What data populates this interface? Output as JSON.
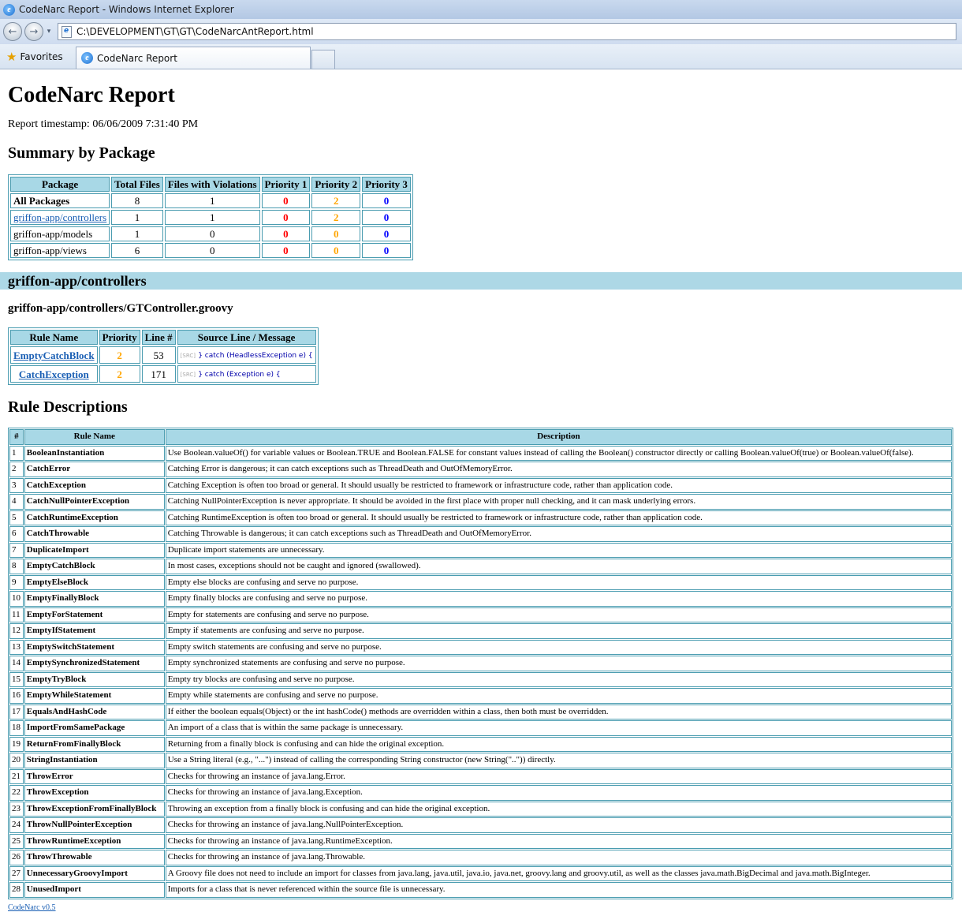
{
  "window": {
    "title": "CodeNarc Report - Windows Internet Explorer",
    "address": "C:\\DEVELOPMENT\\GT\\GT\\CodeNarcAntReport.html",
    "favorites_label": "Favorites",
    "tab_title": "CodeNarc Report",
    "icons": [
      "ie-icon",
      "back-arrow-icon",
      "forward-arrow-icon",
      "star-icon",
      "page-icon"
    ]
  },
  "report": {
    "title": "CodeNarc Report",
    "timestamp": "Report timestamp: 06/06/2009 7:31:40 PM",
    "summary_title": "Summary by Package",
    "summary_headers": [
      "Package",
      "Total Files",
      "Files with Violations",
      "Priority 1",
      "Priority 2",
      "Priority 3"
    ],
    "summary_rows": [
      [
        "All Packages",
        "8",
        "1",
        "0",
        "2",
        "0"
      ],
      [
        "griffon-app/controllers",
        "1",
        "1",
        "0",
        "2",
        "0"
      ],
      [
        "griffon-app/models",
        "1",
        "0",
        "0",
        "0",
        "0"
      ],
      [
        "griffon-app/views",
        "6",
        "0",
        "0",
        "0",
        "0"
      ]
    ],
    "package_header": "griffon-app/controllers",
    "file_title": "griffon-app/controllers/GTController.groovy",
    "violation_headers": [
      "Rule Name",
      "Priority",
      "Line #",
      "Source Line / Message"
    ],
    "violations": [
      {
        "rule": "EmptyCatchBlock",
        "priority": "2",
        "line": "53",
        "src_tag": "[SRC]",
        "source": "} catch (HeadlessException e) {"
      },
      {
        "rule": "CatchException",
        "priority": "2",
        "line": "171",
        "src_tag": "[SRC]",
        "source": "} catch (Exception e) {"
      }
    ],
    "rules_title": "Rule Descriptions",
    "rules_headers": [
      "#",
      "Rule Name",
      "Description"
    ],
    "rules": [
      {
        "n": "1",
        "name": "BooleanInstantiation",
        "desc": "Use Boolean.valueOf() for variable values or Boolean.TRUE and Boolean.FALSE for constant values instead of calling the Boolean() constructor directly or calling Boolean.valueOf(true) or Boolean.valueOf(false)."
      },
      {
        "n": "2",
        "name": "CatchError",
        "desc": "Catching Error is dangerous; it can catch exceptions such as ThreadDeath and OutOfMemoryError."
      },
      {
        "n": "3",
        "name": "CatchException",
        "desc": "Catching Exception is often too broad or general. It should usually be restricted to framework or infrastructure code, rather than application code."
      },
      {
        "n": "4",
        "name": "CatchNullPointerException",
        "desc": "Catching NullPointerException is never appropriate. It should be avoided in the first place with proper null checking, and it can mask underlying errors."
      },
      {
        "n": "5",
        "name": "CatchRuntimeException",
        "desc": "Catching RuntimeException is often too broad or general. It should usually be restricted to framework or infrastructure code, rather than application code."
      },
      {
        "n": "6",
        "name": "CatchThrowable",
        "desc": "Catching Throwable is dangerous; it can catch exceptions such as ThreadDeath and OutOfMemoryError."
      },
      {
        "n": "7",
        "name": "DuplicateImport",
        "desc": "Duplicate import statements are unnecessary."
      },
      {
        "n": "8",
        "name": "EmptyCatchBlock",
        "desc": "In most cases, exceptions should not be caught and ignored (swallowed)."
      },
      {
        "n": "9",
        "name": "EmptyElseBlock",
        "desc": "Empty else blocks are confusing and serve no purpose."
      },
      {
        "n": "10",
        "name": "EmptyFinallyBlock",
        "desc": "Empty finally blocks are confusing and serve no purpose."
      },
      {
        "n": "11",
        "name": "EmptyForStatement",
        "desc": "Empty for statements are confusing and serve no purpose."
      },
      {
        "n": "12",
        "name": "EmptyIfStatement",
        "desc": "Empty if statements are confusing and serve no purpose."
      },
      {
        "n": "13",
        "name": "EmptySwitchStatement",
        "desc": "Empty switch statements are confusing and serve no purpose."
      },
      {
        "n": "14",
        "name": "EmptySynchronizedStatement",
        "desc": "Empty synchronized statements are confusing and serve no purpose."
      },
      {
        "n": "15",
        "name": "EmptyTryBlock",
        "desc": "Empty try blocks are confusing and serve no purpose."
      },
      {
        "n": "16",
        "name": "EmptyWhileStatement",
        "desc": "Empty while statements are confusing and serve no purpose."
      },
      {
        "n": "17",
        "name": "EqualsAndHashCode",
        "desc": "If either the boolean equals(Object) or the int hashCode() methods are overridden within a class, then both must be overridden."
      },
      {
        "n": "18",
        "name": "ImportFromSamePackage",
        "desc": "An import of a class that is within the same package is unnecessary."
      },
      {
        "n": "19",
        "name": "ReturnFromFinallyBlock",
        "desc": "Returning from a finally block is confusing and can hide the original exception."
      },
      {
        "n": "20",
        "name": "StringInstantiation",
        "desc": "Use a String literal (e.g., \"...\") instead of calling the corresponding String constructor (new String(\"..\")) directly."
      },
      {
        "n": "21",
        "name": "ThrowError",
        "desc": "Checks for throwing an instance of java.lang.Error."
      },
      {
        "n": "22",
        "name": "ThrowException",
        "desc": "Checks for throwing an instance of java.lang.Exception."
      },
      {
        "n": "23",
        "name": "ThrowExceptionFromFinallyBlock",
        "desc": "Throwing an exception from a finally block is confusing and can hide the original exception."
      },
      {
        "n": "24",
        "name": "ThrowNullPointerException",
        "desc": "Checks for throwing an instance of java.lang.NullPointerException."
      },
      {
        "n": "25",
        "name": "ThrowRuntimeException",
        "desc": "Checks for throwing an instance of java.lang.RuntimeException."
      },
      {
        "n": "26",
        "name": "ThrowThrowable",
        "desc": "Checks for throwing an instance of java.lang.Throwable."
      },
      {
        "n": "27",
        "name": "UnnecessaryGroovyImport",
        "desc": "A Groovy file does not need to include an import for classes from java.lang, java.util, java.io, java.net, groovy.lang and groovy.util, as well as the classes java.math.BigDecimal and java.math.BigInteger."
      },
      {
        "n": "28",
        "name": "UnusedImport",
        "desc": "Imports for a class that is never referenced within the source file is unnecessary."
      }
    ],
    "footer_link": "CodeNarc v0.5"
  },
  "colors": {
    "priority1": "#ff0000",
    "priority2": "#ffa500",
    "priority3": "#0000ff",
    "header_bg": "#a8d8e6",
    "package_bar": "#add8e6",
    "border": "#4a9cb0"
  }
}
